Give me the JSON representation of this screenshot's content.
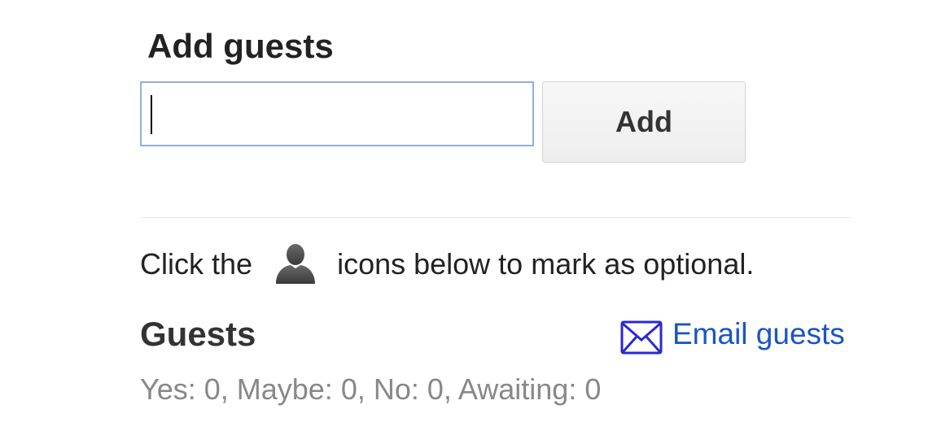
{
  "add_guests": {
    "title": "Add guests",
    "input_value": "",
    "input_placeholder": "",
    "add_button_label": "Add"
  },
  "instruction": {
    "prefix": "Click the",
    "icon": "person-icon",
    "suffix": "icons below to mark as optional."
  },
  "guests": {
    "title": "Guests",
    "email_link": {
      "icon": "mail-icon",
      "label": "Email guests"
    },
    "summary": "Yes: 0, Maybe: 0, No: 0, Awaiting: 0"
  },
  "colors": {
    "link": "#1a56c2",
    "input_border": "#8fb0df",
    "summary_text": "#888888",
    "icon_gray": "#4a4a4a"
  }
}
